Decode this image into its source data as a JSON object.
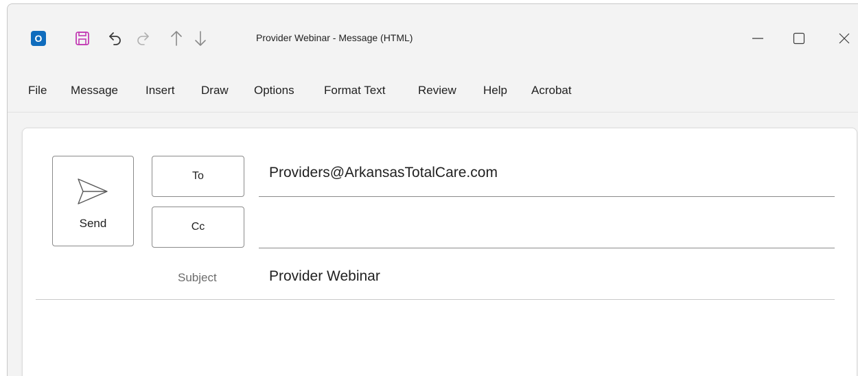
{
  "window": {
    "title": "Provider Webinar - Message (HTML)",
    "app_icon_letter": "O",
    "accent": "#0F6CBD",
    "save_color": "#C239B3"
  },
  "quick_access": {
    "icons": [
      "outlook-app-icon",
      "save-icon",
      "undo-icon",
      "redo-icon",
      "previous-item-icon",
      "next-item-icon"
    ]
  },
  "window_controls": {
    "icons": [
      "minimize-icon",
      "maximize-icon",
      "close-icon"
    ]
  },
  "menu": {
    "items": [
      {
        "label": "File"
      },
      {
        "label": "Message"
      },
      {
        "label": "Insert"
      },
      {
        "label": "Draw"
      },
      {
        "label": "Options"
      },
      {
        "label": "Format Text"
      },
      {
        "label": "Review"
      },
      {
        "label": "Help"
      },
      {
        "label": "Acrobat"
      }
    ]
  },
  "compose": {
    "send_label": "Send",
    "to_label": "To",
    "cc_label": "Cc",
    "to_value": "Providers@ArkansasTotalCare.com",
    "cc_value": "",
    "subject_label": "Subject",
    "subject_value": "Provider Webinar"
  }
}
